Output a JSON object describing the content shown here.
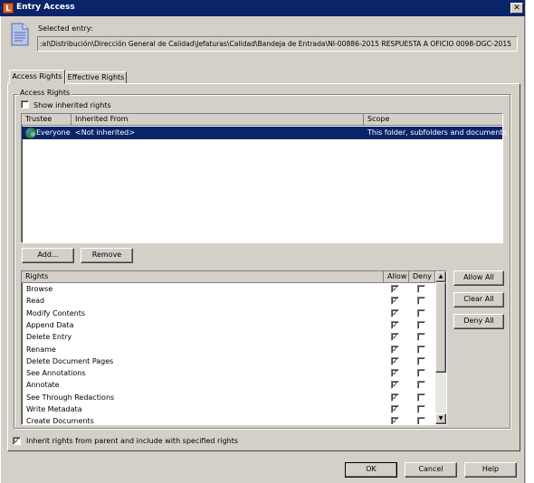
{
  "window": {
    "title": "Entry Access",
    "app_icon_letter": "L",
    "close_glyph": "✕"
  },
  "entry": {
    "label": "Selected entry:",
    "path": ":al\\Distribución\\Dirección General de Calidad\\Jefaturas\\Calidad\\Bandeja de Entrada\\NI-00886-2015 RESPUESTA A OFICIO 0098-DGC-2015"
  },
  "tabs": [
    {
      "label": "Access Rights",
      "active": true
    },
    {
      "label": "Effective Rights",
      "active": false
    }
  ],
  "access_rights": {
    "group_label": "Access Rights",
    "show_inherited_label": "Show inherited rights",
    "show_inherited_checked": false,
    "columns": [
      "Trustee",
      "Inherited From",
      "Scope"
    ],
    "rows": [
      {
        "trustee": "Everyone",
        "inherited_from": "<Not inherited>",
        "scope": "This folder, subfolders and documents",
        "selected": true
      }
    ],
    "add_button": "Add...",
    "remove_button": "Remove"
  },
  "rights": {
    "columns": {
      "rights": "Rights",
      "allow": "Allow",
      "deny": "Deny"
    },
    "items": [
      {
        "name": "Browse",
        "allow": true,
        "deny": false
      },
      {
        "name": "Read",
        "allow": true,
        "deny": false
      },
      {
        "name": "Modify Contents",
        "allow": true,
        "deny": false
      },
      {
        "name": "Append Data",
        "allow": true,
        "deny": false
      },
      {
        "name": "Delete Entry",
        "allow": true,
        "deny": false
      },
      {
        "name": "Rename",
        "allow": true,
        "deny": false
      },
      {
        "name": "Delete Document Pages",
        "allow": true,
        "deny": false
      },
      {
        "name": "See Annotations",
        "allow": true,
        "deny": false
      },
      {
        "name": "Annotate",
        "allow": true,
        "deny": false
      },
      {
        "name": "See Through Redactions",
        "allow": true,
        "deny": false
      },
      {
        "name": "Write Metadata",
        "allow": true,
        "deny": false
      },
      {
        "name": "Create Documents",
        "allow": true,
        "deny": false
      }
    ],
    "allow_all_button": "Allow All",
    "clear_all_button": "Clear All",
    "deny_all_button": "Deny All"
  },
  "inherit": {
    "label": "Inherit rights from parent and include with specified rights",
    "checked": true
  },
  "footer": {
    "ok": "OK",
    "cancel": "Cancel",
    "help": "Help"
  },
  "glyphs": {
    "check": "✓",
    "scroll_up": "▲",
    "scroll_down": "▼"
  },
  "colors": {
    "titlebar": "#0a246a",
    "selection": "#0a246a",
    "face": "#d4d0c8"
  }
}
